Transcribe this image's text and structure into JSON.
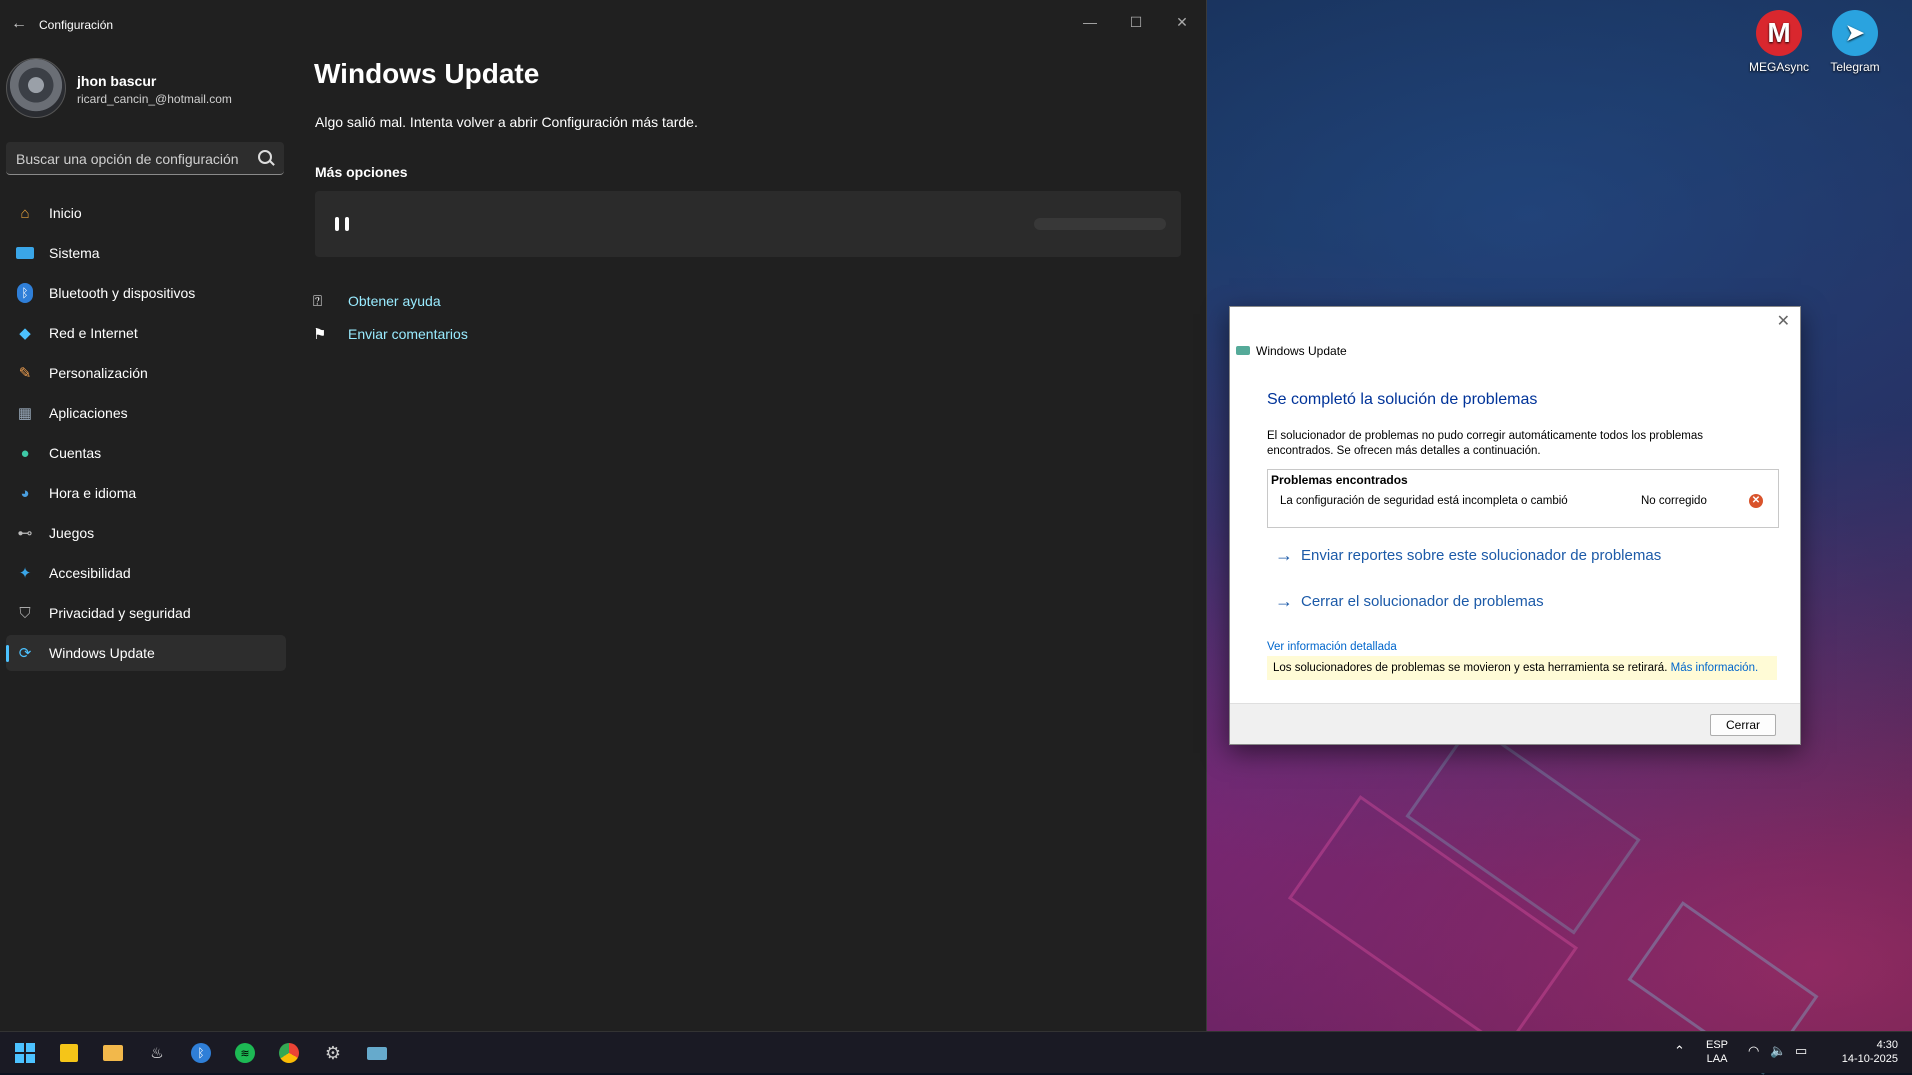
{
  "desktop": {
    "icons": [
      {
        "label": "MEGAsync",
        "glyph": "M",
        "color": "#d9272e"
      },
      {
        "label": "Telegram",
        "glyph": "➤",
        "color": "#2aa3df"
      }
    ]
  },
  "settings": {
    "app_title": "Configuración",
    "user": {
      "name": "jhon bascur",
      "email": "ricard_cancin_@hotmail.com"
    },
    "search_placeholder": "Buscar una opción de configuración",
    "nav": [
      {
        "label": "Inicio",
        "icon": "home-icon"
      },
      {
        "label": "Sistema",
        "icon": "system-icon"
      },
      {
        "label": "Bluetooth y dispositivos",
        "icon": "bluetooth-icon"
      },
      {
        "label": "Red e Internet",
        "icon": "network-icon"
      },
      {
        "label": "Personalización",
        "icon": "brush-icon"
      },
      {
        "label": "Aplicaciones",
        "icon": "apps-icon"
      },
      {
        "label": "Cuentas",
        "icon": "account-icon"
      },
      {
        "label": "Hora e idioma",
        "icon": "globe-clock-icon"
      },
      {
        "label": "Juegos",
        "icon": "gamepad-icon"
      },
      {
        "label": "Accesibilidad",
        "icon": "accessibility-icon"
      },
      {
        "label": "Privacidad y seguridad",
        "icon": "shield-icon"
      },
      {
        "label": "Windows Update",
        "icon": "update-icon",
        "active": true
      }
    ],
    "main": {
      "title": "Windows Update",
      "error_message": "Algo salió mal. Intenta volver a abrir Configuración más tarde.",
      "more_options": "Más opciones",
      "links": {
        "help": "Obtener ayuda",
        "feedback": "Enviar comentarios"
      }
    }
  },
  "dialog": {
    "title": "Windows Update",
    "heading": "Se completó la solución de problemas",
    "description": "El solucionador de problemas no pudo corregir automáticamente todos los problemas encontrados. Se ofrecen más detalles a continuación.",
    "problems_header": "Problemas encontrados",
    "problem": "La configuración de seguridad está incompleta o cambió",
    "problem_status": "No corregido",
    "link_send_reports": "Enviar reportes sobre este solucionador de problemas",
    "link_close_troubleshooter": "Cerrar el solucionador de problemas",
    "detail_link": "Ver información detallada",
    "banner_text": "Los solucionadores de problemas se movieron y esta herramienta se retirará.",
    "banner_link": "Más información.",
    "close_button": "Cerrar"
  },
  "taskbar": {
    "apps": [
      "start-icon",
      "sticky-notes-icon",
      "file-explorer-icon",
      "steam-icon",
      "bluetooth-app-icon",
      "spotify-icon",
      "chrome-icon",
      "settings-gear-icon",
      "windows-update-app-icon"
    ],
    "language": "ESP",
    "layout": "LAA",
    "time": "4:30",
    "date": "14-10-2025"
  }
}
